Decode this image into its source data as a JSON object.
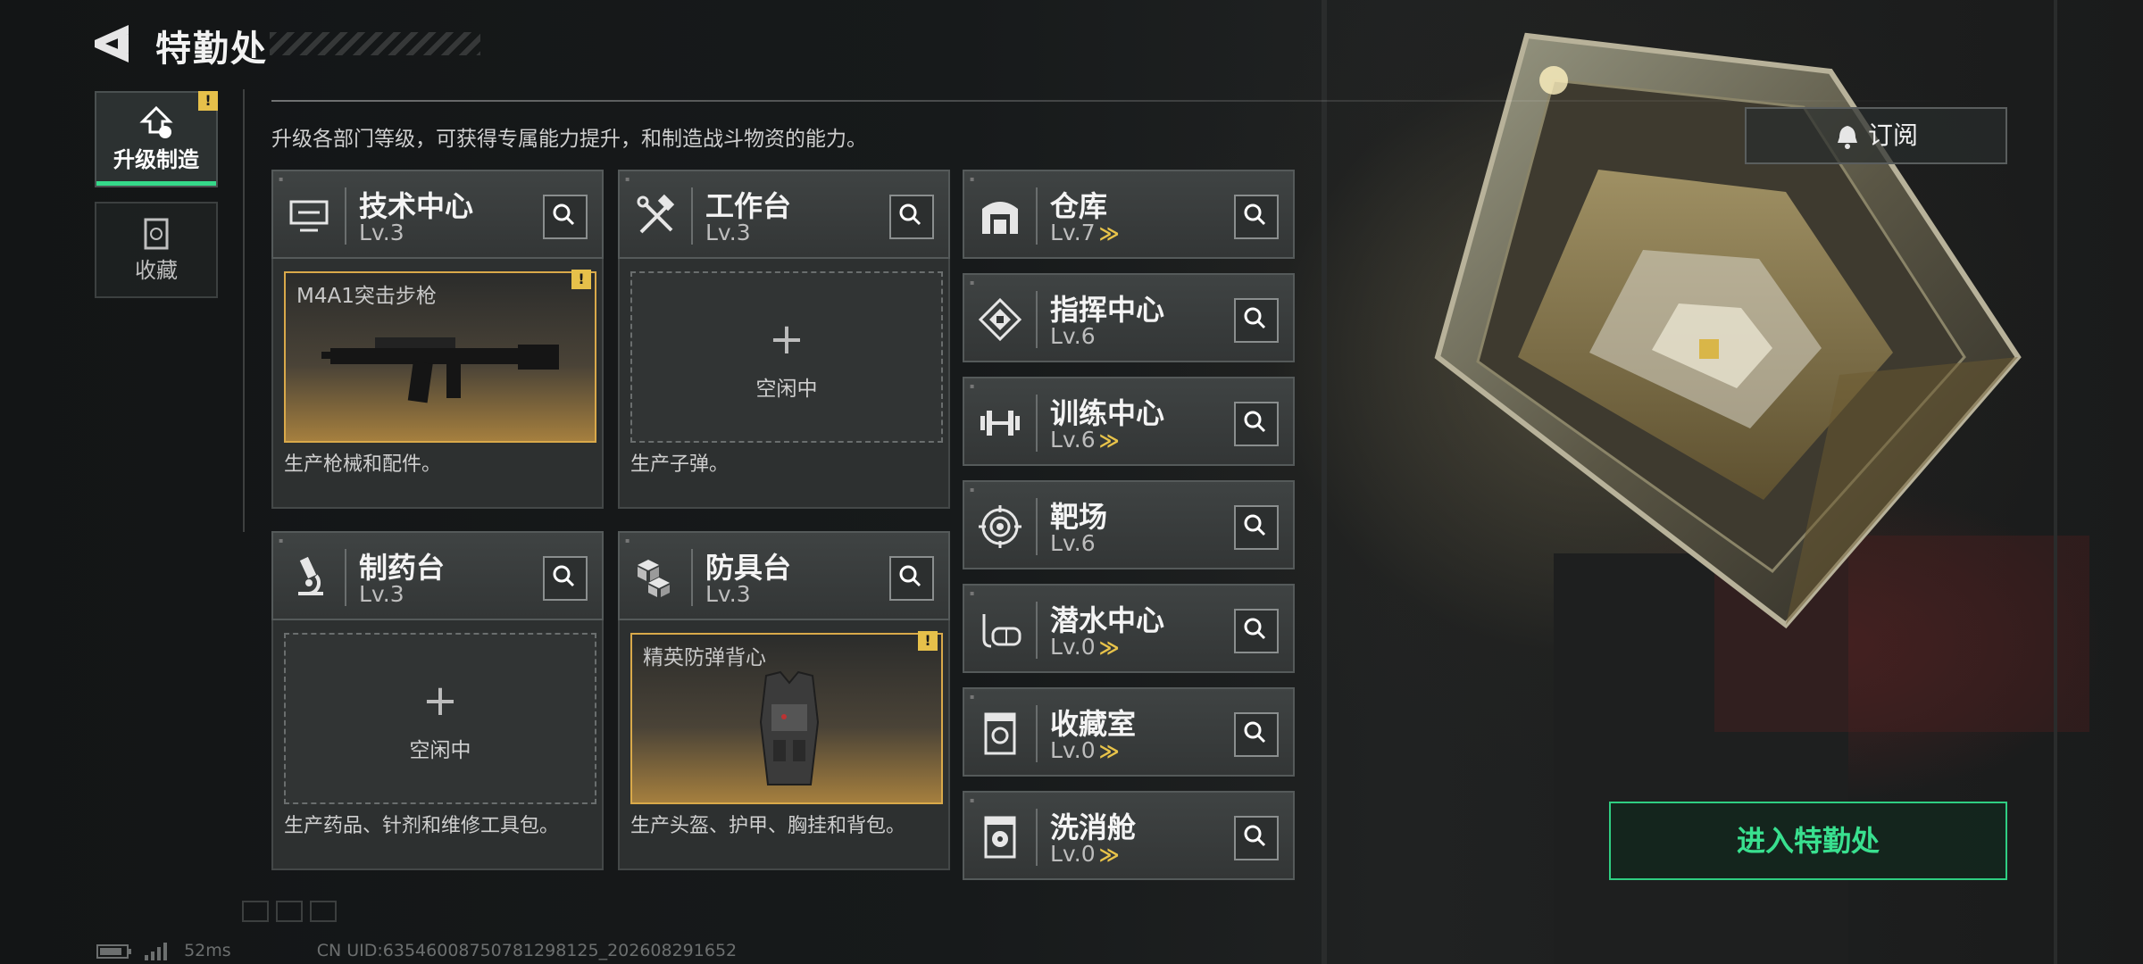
{
  "header": {
    "title": "特勤处"
  },
  "nav": [
    {
      "label": "升级制造",
      "badge": "!"
    },
    {
      "label": "收藏"
    }
  ],
  "description": "升级各部门等级，可获得专属能力提升，和制造战斗物资的能力。",
  "cards": [
    {
      "name": "技术中心",
      "level": "Lv.3",
      "slot_item": "M4A1突击步枪",
      "slot_badge": "!",
      "produce": "生产枪械和配件。"
    },
    {
      "name": "工作台",
      "level": "Lv.3",
      "plus": "+",
      "idle": "空闲中",
      "produce": "生产子弹。"
    },
    {
      "name": "制药台",
      "level": "Lv.3",
      "plus": "+",
      "idle": "空闲中",
      "produce": "生产药品、针剂和维修工具包。"
    },
    {
      "name": "防具台",
      "level": "Lv.3",
      "slot_item": "精英防弹背心",
      "slot_badge": "!",
      "produce": "生产头盔、护甲、胸挂和背包。"
    }
  ],
  "departments": [
    {
      "name": "仓库",
      "level": "Lv.7",
      "upgradable": true
    },
    {
      "name": "指挥中心",
      "level": "Lv.6",
      "upgradable": false
    },
    {
      "name": "训练中心",
      "level": "Lv.6",
      "upgradable": true
    },
    {
      "name": "靶场",
      "level": "Lv.6",
      "upgradable": false
    },
    {
      "name": "潜水中心",
      "level": "Lv.0",
      "upgradable": true
    },
    {
      "name": "收藏室",
      "level": "Lv.0",
      "upgradable": true
    },
    {
      "name": "洗消舱",
      "level": "Lv.0",
      "upgradable": true
    }
  ],
  "upgrade_glyph": "≫",
  "subscribe_label": "订阅",
  "enter_label": "进入特勤处",
  "footer": {
    "ping": "52ms",
    "uid": "CN UID:63546008750781298125_202608291652"
  },
  "colors": {
    "accent_green": "#35d98a",
    "badge_yellow": "#e6c04a",
    "slot_gold": "#d9a94a"
  }
}
